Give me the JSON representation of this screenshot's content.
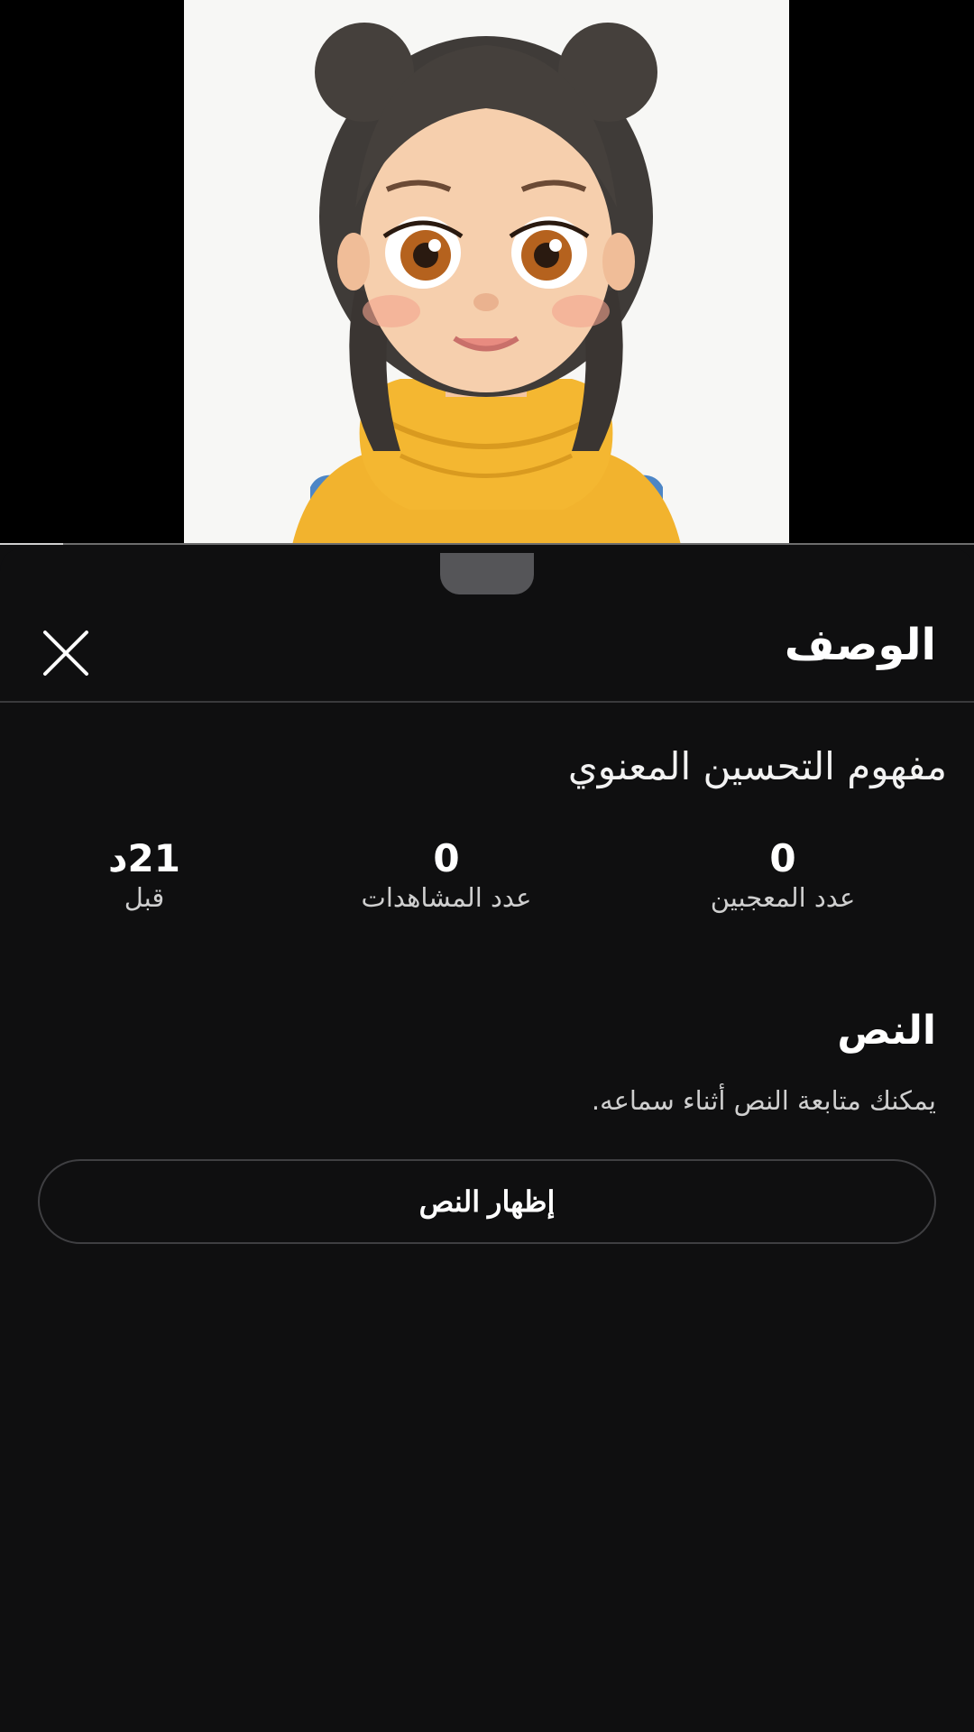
{
  "player": {
    "progress_fraction": 0.065,
    "thumbnail_icon": "cartoon-girl-illustration"
  },
  "sheet": {
    "title": "الوصف",
    "close_icon": "close-icon"
  },
  "video": {
    "title": "مفهوم التحسين المعنوي"
  },
  "stats": {
    "likes_value": "0",
    "likes_label": "عدد المعجبين",
    "views_value": "0",
    "views_label": "عدد المشاهدات",
    "time_value": "21د",
    "time_label": "قبل"
  },
  "transcript": {
    "heading": "النص",
    "description": "يمكنك متابعة النص أثناء سماعه.",
    "button_label": "إظهار النص"
  },
  "colors": {
    "background": "#0f0f10",
    "divider": "#3a3a3c",
    "secondary_text": "#cfcfcf"
  }
}
